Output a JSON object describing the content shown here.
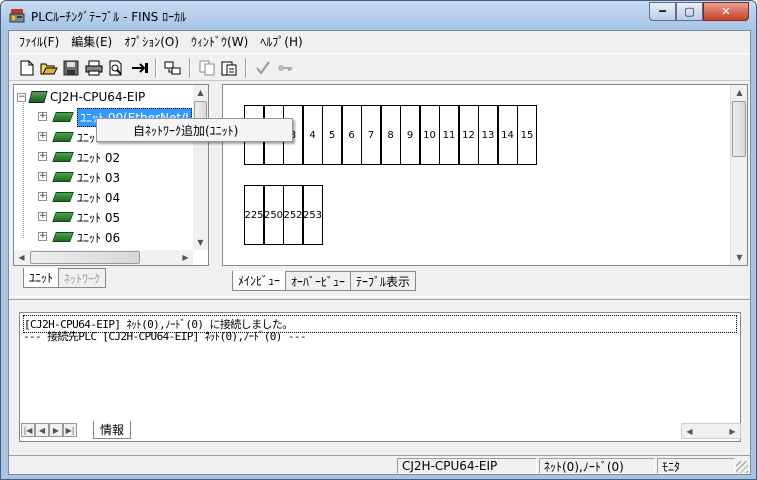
{
  "window": {
    "title": "PLCﾙｰﾁﾝｸﾞﾃｰﾌﾞﾙ - FINS ﾛｰｶﾙ",
    "min_glyph": "━",
    "max_glyph": "▢",
    "close_glyph": "✕"
  },
  "menu": [
    "ﾌｧｲﾙ(F)",
    "編集(E)",
    "ｵﾌﾟｼｮﾝ(O)",
    "ｳｨﾝﾄﾞｳ(W)",
    "ﾍﾙﾌﾟ(H)"
  ],
  "toolbar": {
    "icons": [
      "new-icon",
      "open-icon",
      "save-icon",
      "print-icon",
      "print-preview-icon",
      "transfer-icon",
      "compare-icon",
      "copy-icon",
      "paste-icon",
      "check-icon",
      "key-icon"
    ]
  },
  "tree": {
    "root": "CJ2H-CPU64-EIP",
    "units": [
      "ﾕﾆｯﾄ 00(EtherNet/I",
      "ﾕﾆｯﾄ 01",
      "ﾕﾆｯﾄ 02",
      "ﾕﾆｯﾄ 03",
      "ﾕﾆｯﾄ 04",
      "ﾕﾆｯﾄ 05",
      "ﾕﾆｯﾄ 06"
    ],
    "expand_glyph": "+",
    "collapse_glyph": "−"
  },
  "context_menu": {
    "item": "自ﾈｯﾄﾜｰｸ追加(ﾕﾆｯﾄ)"
  },
  "left_tabs": [
    "ﾕﾆｯﾄ",
    "ﾈｯﾄﾜｰｸ"
  ],
  "main_view": {
    "row1": [
      "1",
      "2",
      "3",
      "4",
      "5",
      "6",
      "7",
      "8",
      "9",
      "10",
      "11",
      "12",
      "13",
      "14",
      "15"
    ],
    "row2": [
      "225",
      "250",
      "252",
      "253"
    ]
  },
  "main_tabs": [
    "ﾒｲﾝﾋﾞｭｰ",
    "ｵｰﾊﾞｰﾋﾞｭｰ",
    "ﾃｰﾌﾞﾙ表示"
  ],
  "log": {
    "lines": [
      "[CJ2H-CPU64-EIP] ﾈｯﾄ(0),ﾉｰﾄﾞ(0) に接続しました。",
      "--- 接続先PLC [CJ2H-CPU64-EIP] ﾈｯﾄ(0),ﾉｰﾄﾞ(0) ---"
    ],
    "tab": "情報"
  },
  "status": {
    "device": "CJ2H-CPU64-EIP",
    "address": "ﾈｯﾄ(0),ﾉｰﾄﾞ(0)",
    "mode": "ﾓﾆﾀ"
  }
}
